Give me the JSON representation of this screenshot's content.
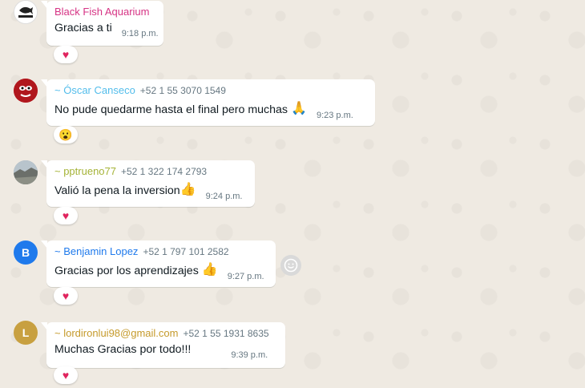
{
  "messages": [
    {
      "sender": "Black Fish Aquarium",
      "sender_color": "#d63384",
      "phone": "",
      "text": "Gracias a ti",
      "time": "9:18 p.m.",
      "reaction": "♥",
      "avatar_type": "logo-icon",
      "avatar_letter": ""
    },
    {
      "sender": "~ Óscar Canseco",
      "sender_color": "#53bdeb",
      "phone": "+52 1 55 3070 1549",
      "text": "No pude quedarme hasta el final pero muchas",
      "inline_emoji": "🙏",
      "time": "9:23 p.m.",
      "reaction": "😮",
      "avatar_type": "photo-avatar",
      "avatar_letter": ""
    },
    {
      "sender": "~ pptrueno77",
      "sender_color": "#a5b337",
      "phone": "+52 1 322 174 2793",
      "text": "Valió la pena la inversion",
      "inline_emoji": "👍",
      "time": "9:24 p.m.",
      "reaction": "♥",
      "avatar_type": "photo-avatar",
      "avatar_letter": ""
    },
    {
      "sender": "~ Benjamin Lopez",
      "sender_color": "#1f7aec",
      "phone": "+52 1 797 101 2582",
      "text": "Gracias por los aprendizajes",
      "inline_emoji": "👍",
      "time": "9:27 p.m.",
      "reaction": "♥",
      "avatar_type": "letter",
      "avatar_letter": "B",
      "avatar_color": "#1f7aec"
    },
    {
      "sender": "~ lordironlui98@gmail.com",
      "sender_color": "#c59a2b",
      "phone": "+52 1 55 1931 8635",
      "text": "Muchas Gracias por todo!!!",
      "time": "9:39 p.m.",
      "reaction": "♥",
      "avatar_type": "letter",
      "avatar_letter": "L",
      "avatar_color": "#c8a040"
    }
  ],
  "react_button_icon": "smiley-icon"
}
